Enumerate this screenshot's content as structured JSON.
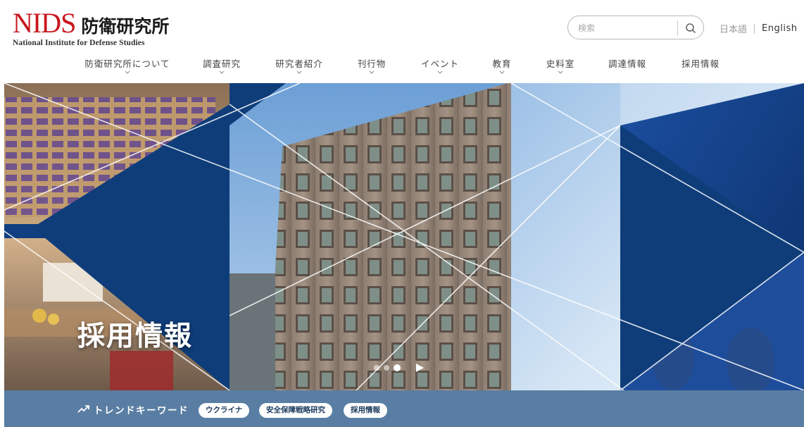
{
  "header": {
    "logo_abbr": "NIDS",
    "logo_ja": "防衛研究所",
    "logo_en": "National Institute for Defense Studies"
  },
  "search": {
    "placeholder": "検索",
    "icon": "search-icon"
  },
  "lang": {
    "ja": "日本語",
    "en": "English"
  },
  "nav": {
    "items": [
      {
        "label": "防衛研究所について",
        "has_dropdown": true
      },
      {
        "label": "調査研究",
        "has_dropdown": true
      },
      {
        "label": "研究者紹介",
        "has_dropdown": true
      },
      {
        "label": "刊行物",
        "has_dropdown": true
      },
      {
        "label": "イベント",
        "has_dropdown": true
      },
      {
        "label": "教育",
        "has_dropdown": true
      },
      {
        "label": "史料室",
        "has_dropdown": true
      },
      {
        "label": "調達情報",
        "has_dropdown": false
      },
      {
        "label": "採用情報",
        "has_dropdown": false
      }
    ]
  },
  "hero": {
    "title": "採用情報",
    "slides_total": 3,
    "active_slide": 3,
    "play_icon": "play-icon"
  },
  "trend": {
    "label": "トレンドキーワード",
    "icon": "trending-up-icon",
    "keywords": [
      "ウクライナ",
      "安全保障戦略研究",
      "採用情報"
    ]
  },
  "colors": {
    "brand_red": "#c8171e",
    "navy": "#0e3d7a",
    "trend_bar": "#5a7ea3"
  }
}
